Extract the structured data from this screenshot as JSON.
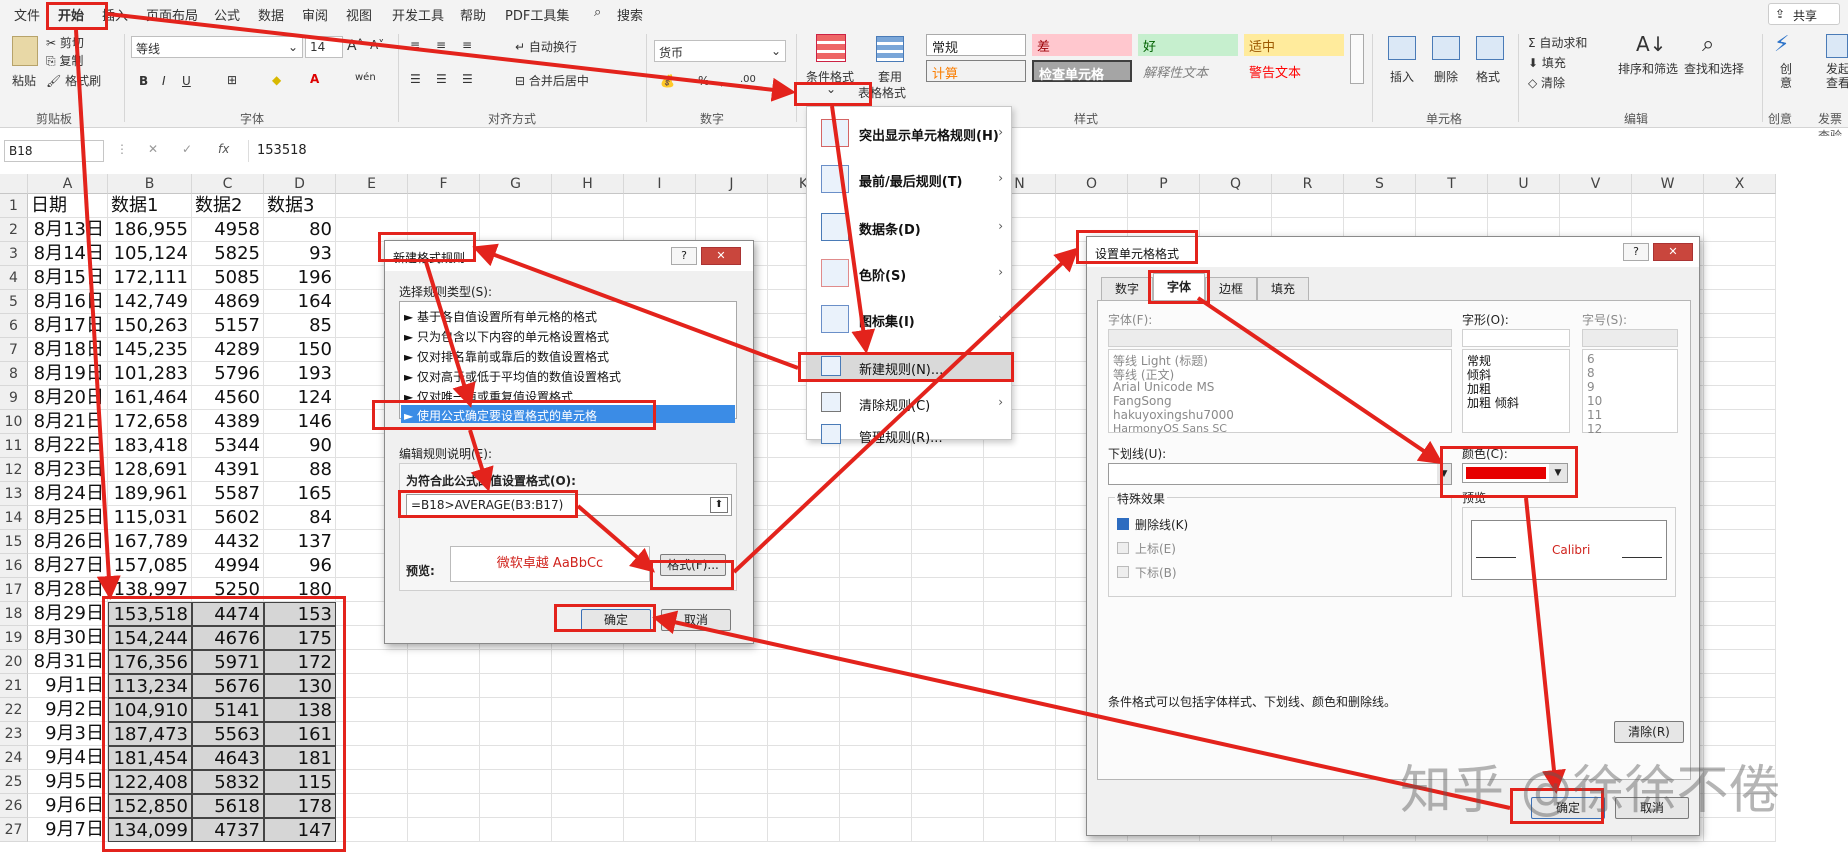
{
  "menu": [
    "文件",
    "开始",
    "插入",
    "页面布局",
    "公式",
    "数据",
    "审阅",
    "视图",
    "开发工具",
    "帮助",
    "PDF工具集"
  ],
  "search_label": "搜索",
  "share_label": "共享",
  "ribbon": {
    "clipboard": {
      "paste": "粘贴",
      "cut": "剪切",
      "copy": "复制",
      "format_painter": "格式刷",
      "label": "剪贴板"
    },
    "font": {
      "name": "等线",
      "size": "14",
      "label": "字体"
    },
    "align": {
      "wrap": "自动换行",
      "merge": "合并后居中",
      "label": "对齐方式"
    },
    "number": {
      "format": "货币",
      "label": "数字"
    },
    "styles": {
      "cond_format_1": "条件格式",
      "table_format_1": "套用",
      "table_format_2": "表格格式",
      "normal": "常规",
      "bad": "差",
      "good": "好",
      "neutral": "适中",
      "calc": "计算",
      "check": "检查单元格",
      "explain": "解释性文本",
      "warn": "警告文本",
      "label": "样式"
    },
    "cells": {
      "insert": "插入",
      "delete": "删除",
      "format": "格式",
      "label": "单元格"
    },
    "edit": {
      "autosum": "自动求和",
      "fill": "填充",
      "clear": "清除",
      "sort": "排序和筛选",
      "find": "查找和选择",
      "label": "编辑"
    },
    "create": {
      "a": "创",
      "b": "意",
      "label": "创意"
    },
    "send": {
      "a": "发起",
      "b": "查看",
      "label": "发票查验"
    }
  },
  "formula_bar": {
    "name_box": "B18",
    "fx": "fx",
    "value": "153518"
  },
  "columns": [
    "A",
    "B",
    "C",
    "D",
    "E",
    "F",
    "G",
    "H",
    "I",
    "J",
    "K",
    "L",
    "M",
    "N",
    "O",
    "P",
    "Q",
    "R",
    "S",
    "T",
    "U",
    "V",
    "W",
    "X"
  ],
  "header_row": [
    "日期",
    "数据1",
    "数据2",
    "数据3"
  ],
  "rows": [
    [
      "8月13日",
      "186,955",
      "4958",
      "80"
    ],
    [
      "8月14日",
      "105,124",
      "5825",
      "93"
    ],
    [
      "8月15日",
      "172,111",
      "5085",
      "196"
    ],
    [
      "8月16日",
      "142,749",
      "4869",
      "164"
    ],
    [
      "8月17日",
      "150,263",
      "5157",
      "85"
    ],
    [
      "8月18日",
      "145,235",
      "4289",
      "150"
    ],
    [
      "8月19日",
      "101,283",
      "5796",
      "193"
    ],
    [
      "8月20日",
      "161,464",
      "4560",
      "124"
    ],
    [
      "8月21日",
      "172,658",
      "4389",
      "146"
    ],
    [
      "8月22日",
      "183,418",
      "5344",
      "90"
    ],
    [
      "8月23日",
      "128,691",
      "4391",
      "88"
    ],
    [
      "8月24日",
      "189,961",
      "5587",
      "165"
    ],
    [
      "8月25日",
      "115,031",
      "5602",
      "84"
    ],
    [
      "8月26日",
      "167,789",
      "4432",
      "137"
    ],
    [
      "8月27日",
      "157,085",
      "4994",
      "96"
    ],
    [
      "8月28日",
      "138,997",
      "5250",
      "180"
    ],
    [
      "8月29日",
      "153,518",
      "4474",
      "153"
    ],
    [
      "8月30日",
      "154,244",
      "4676",
      "175"
    ],
    [
      "8月31日",
      "176,356",
      "5971",
      "172"
    ],
    [
      "9月1日",
      "113,234",
      "5676",
      "130"
    ],
    [
      "9月2日",
      "104,910",
      "5141",
      "138"
    ],
    [
      "9月3日",
      "187,473",
      "5563",
      "161"
    ],
    [
      "9月4日",
      "181,454",
      "4643",
      "181"
    ],
    [
      "9月5日",
      "122,408",
      "5832",
      "115"
    ],
    [
      "9月6日",
      "152,850",
      "5618",
      "178"
    ],
    [
      "9月7日",
      "134,099",
      "4737",
      "147"
    ]
  ],
  "cf_menu": [
    {
      "label": "突出显示单元格规则(H)",
      "arrow": true
    },
    {
      "label": "最前/最后规则(T)",
      "arrow": true
    },
    {
      "label": "数据条(D)",
      "arrow": true
    },
    {
      "label": "色阶(S)",
      "arrow": true
    },
    {
      "label": "图标集(I)",
      "arrow": true
    },
    {
      "label": "新建规则(N)...",
      "arrow": false
    },
    {
      "label": "清除规则(C)",
      "arrow": true
    },
    {
      "label": "管理规则(R)...",
      "arrow": false
    }
  ],
  "new_rule_dialog": {
    "title": "新建格式规则",
    "help": "?",
    "close": "✕",
    "select_type": "选择规则类型(S):",
    "types": [
      "► 基于各自值设置所有单元格的格式",
      "► 只为包含以下内容的单元格设置格式",
      "► 仅对排名靠前或靠后的数值设置格式",
      "► 仅对高于或低于平均值的数值设置格式",
      "► 仅对唯一值或重复值设置格式",
      "► 使用公式确定要设置格式的单元格"
    ],
    "edit_desc": "编辑规则说明(E):",
    "formula_label": "为符合此公式的值设置格式(O):",
    "formula": "=B18>AVERAGE(B3:B17)",
    "preview_label": "预览:",
    "preview_text": "微软卓越  AaBbCc",
    "format_btn": "格式(F)...",
    "ok": "确定",
    "cancel": "取消"
  },
  "format_cells_dialog": {
    "title": "设置单元格格式",
    "help": "?",
    "close": "✕",
    "tabs": [
      "数字",
      "字体",
      "边框",
      "填充"
    ],
    "font_label": "字体(F):",
    "style_label": "字形(O):",
    "size_label": "字号(S):",
    "fonts": [
      "等线 Light (标题)",
      "等线 (正文)",
      "Arial Unicode MS",
      "FangSong",
      "hakuyoxingshu7000",
      "HarmonyOS Sans SC"
    ],
    "styles": [
      "常规",
      "倾斜",
      "加粗",
      "加粗 倾斜"
    ],
    "sizes": [
      "6",
      "8",
      "9",
      "10",
      "11",
      "12"
    ],
    "underline_label": "下划线(U):",
    "color_label": "颜色(C):",
    "color_value": "#e60000",
    "effects_label": "特殊效果",
    "strike": "删除线(K)",
    "superscript": "上标(E)",
    "subscript": "下标(B)",
    "preview_label": "预览",
    "preview_text": "Calibri",
    "note": "条件格式可以包括字体样式、下划线、颜色和删除线。",
    "clear": "清除(R)",
    "ok": "确定",
    "cancel": "取消"
  },
  "watermark": "知乎 @徐徐不倦",
  "annotation_color": "#e3231c"
}
